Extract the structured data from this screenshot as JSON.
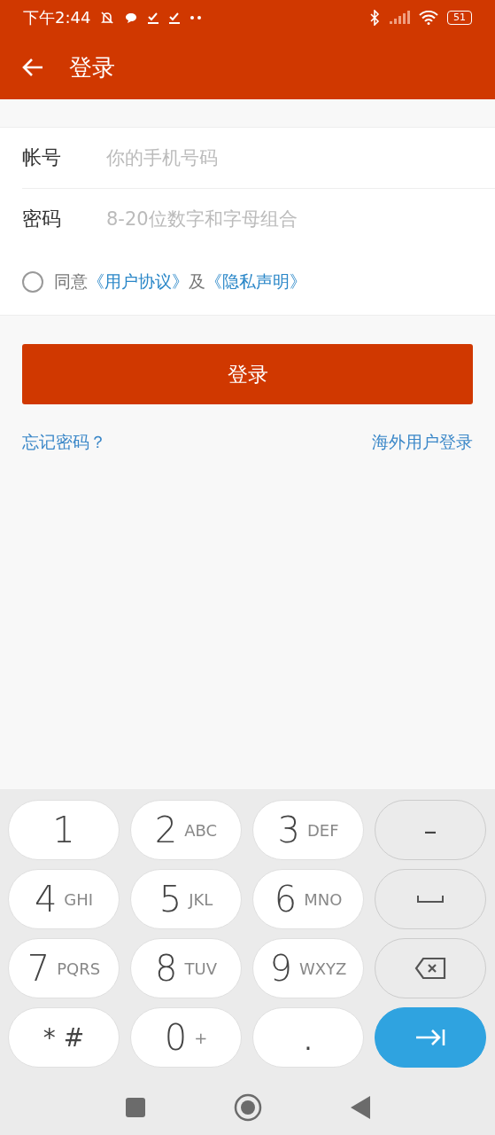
{
  "status_bar": {
    "time": "下午2:44",
    "battery": "51"
  },
  "app_bar": {
    "title": "登录"
  },
  "fields": [
    {
      "label": "帐号",
      "placeholder": "你的手机号码"
    },
    {
      "label": "密码",
      "placeholder": "8-20位数字和字母组合"
    }
  ],
  "agreement": {
    "checked": false,
    "prefix": "同意",
    "link_1": "《用户协议》",
    "joiner": "及",
    "link_2": "《隐私声明》"
  },
  "login_button": "登录",
  "links": {
    "forgot": "忘记密码？",
    "overseas": "海外用户登录"
  },
  "keyboard": {
    "keys": [
      {
        "kind": "digit",
        "main": "1"
      },
      {
        "kind": "digit",
        "main": "2",
        "letters": "ABC"
      },
      {
        "kind": "digit",
        "main": "3",
        "letters": "DEF"
      },
      {
        "kind": "function",
        "main": "–"
      },
      {
        "kind": "digit",
        "main": "4",
        "letters": "GHI"
      },
      {
        "kind": "digit",
        "main": "5",
        "letters": "JKL"
      },
      {
        "kind": "digit",
        "main": "6",
        "letters": "MNO"
      },
      {
        "kind": "space"
      },
      {
        "kind": "digit",
        "main": "7",
        "letters": "PQRS"
      },
      {
        "kind": "digit",
        "main": "8",
        "letters": "TUV"
      },
      {
        "kind": "digit",
        "main": "9",
        "letters": "WXYZ"
      },
      {
        "kind": "backspace"
      },
      {
        "kind": "symbol",
        "main": "* #"
      },
      {
        "kind": "digit",
        "main": "0",
        "letters": "+"
      },
      {
        "kind": "dot",
        "main": "."
      },
      {
        "kind": "next"
      }
    ]
  }
}
